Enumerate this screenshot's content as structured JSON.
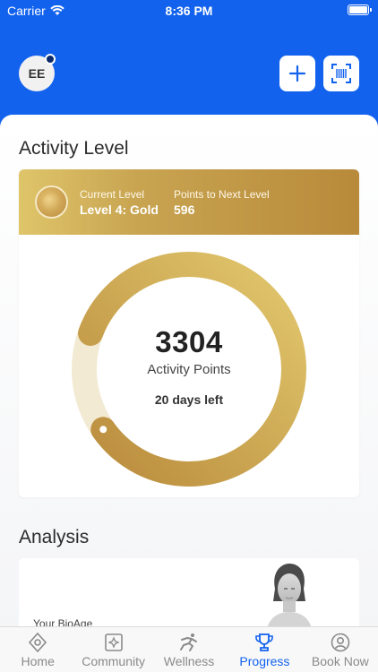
{
  "status_bar": {
    "carrier": "Carrier",
    "time": "8:36 PM"
  },
  "header": {
    "avatar_initials": "EE"
  },
  "activity": {
    "title": "Activity Level",
    "current_level_label": "Current Level",
    "current_level_value": "Level 4: Gold",
    "points_next_label": "Points to Next Level",
    "points_next_value": "596",
    "points": "3304",
    "points_label": "Activity Points",
    "days_left": "20 days left",
    "progress_fraction": 0.847
  },
  "analysis": {
    "title": "Analysis",
    "card_label": "Your BioAge"
  },
  "tabs": [
    {
      "label": "Home",
      "icon": "home-icon"
    },
    {
      "label": "Community",
      "icon": "community-icon"
    },
    {
      "label": "Wellness",
      "icon": "wellness-icon"
    },
    {
      "label": "Progress",
      "icon": "trophy-icon"
    },
    {
      "label": "Book Now",
      "icon": "person-icon"
    }
  ],
  "colors": {
    "brand_blue": "#1262ee",
    "gold_light": "#dfc56a",
    "gold_dark": "#b88a3a",
    "ring_track": "#f3ead4"
  }
}
